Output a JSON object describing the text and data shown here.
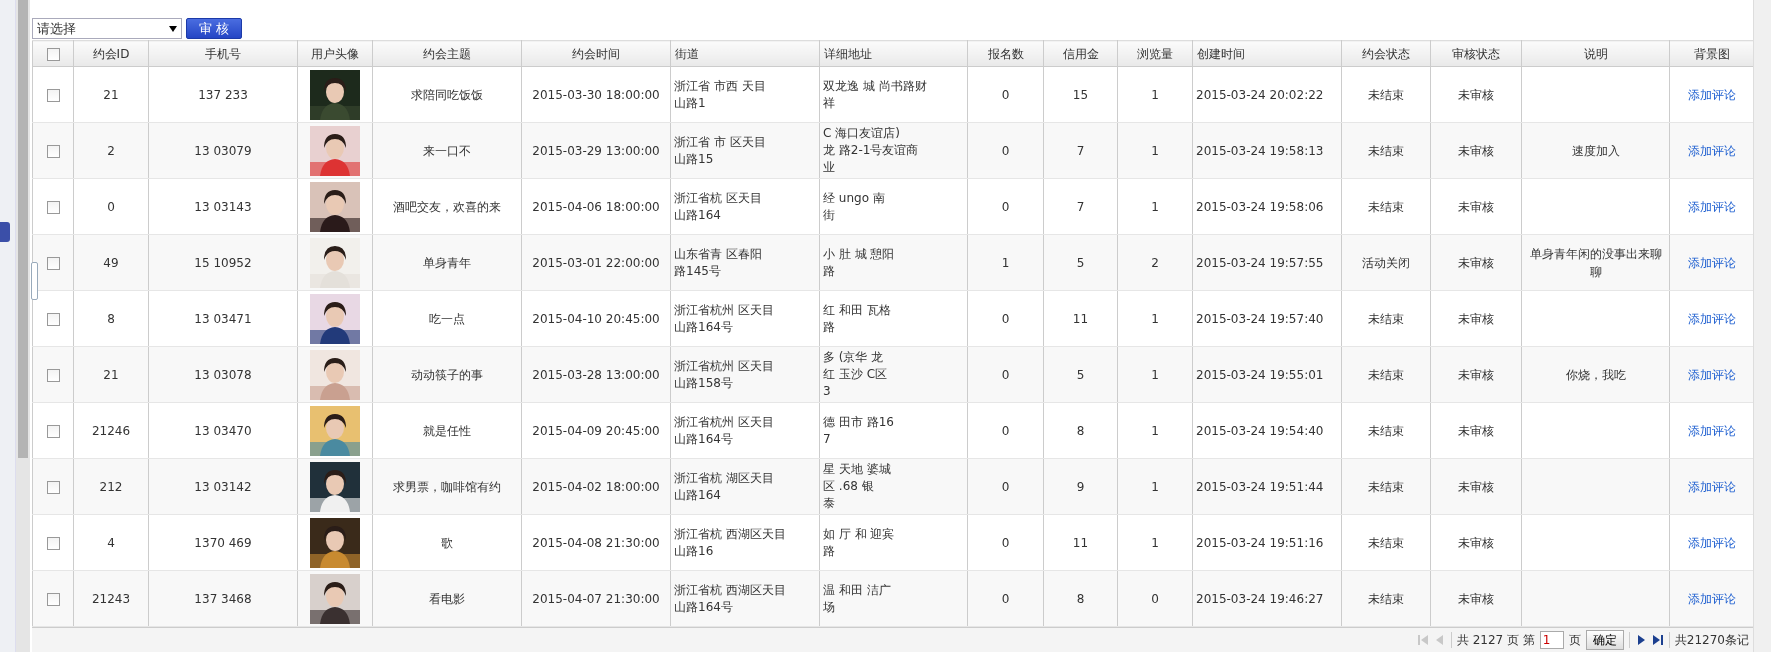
{
  "toolbar": {
    "select": {
      "value": "请选择"
    },
    "button": "审 核"
  },
  "table": {
    "header_checkbox": {
      "checked": false
    },
    "columns": [
      "约会ID",
      "手机号",
      "用户头像",
      "约会主题",
      "约会时间",
      "街道",
      "详细地址",
      "报名数",
      "信用金",
      "浏览量",
      "创建时间",
      "约会状态",
      "审核状态",
      "说明",
      "背景图"
    ],
    "rows": [
      {
        "checked": false,
        "id": "21",
        "phone": "137 233",
        "avatar": {
          "kind": "picture"
        },
        "subject": "求陪同吃饭饭",
        "time": "2015-03-30 18:00:00",
        "street": [
          "浙江省 市西 天目",
          "山路1"
        ],
        "address": [
          "双龙逸 城 尚书路财",
          "祥"
        ],
        "signups": "0",
        "credit": "15",
        "views": "1",
        "created": "2015-03-24 20:02:22",
        "status": "未结束",
        "review": "未审核",
        "action": "添加评论"
      },
      {
        "checked": false,
        "id": "2",
        "phone": "13 03079",
        "avatar": {
          "kind": "picture"
        },
        "subject": "来一口不",
        "time": "2015-03-29 13:00:00",
        "street": [
          "浙江省 市 区天目",
          "山路15"
        ],
        "address": [
          "C 海口友谊店)",
          "龙 路2-1号友谊商",
          "业"
        ],
        "signups": "0",
        "credit": "7",
        "views": "1",
        "created": "2015-03-24 19:58:13",
        "status": "未结束",
        "review": "未审核",
        "note": "速度加入",
        "action": "添加评论"
      },
      {
        "checked": false,
        "id": "0",
        "phone": "13 03143",
        "avatar": {
          "kind": "picture"
        },
        "subject": "酒吧交友，欢喜的来",
        "time": "2015-04-06 18:00:00",
        "street": [
          "浙江省杭 区天目",
          "山路164"
        ],
        "address": [
          "经 ungo 南",
          "街"
        ],
        "signups": "0",
        "credit": "7",
        "views": "1",
        "created": "2015-03-24 19:58:06",
        "status": "未结束",
        "review": "未审核",
        "action": "添加评论"
      },
      {
        "checked": false,
        "id": "49",
        "phone": "15 10952",
        "avatar": {
          "kind": "picture"
        },
        "subject": "单身青年",
        "time": "2015-03-01 22:00:00",
        "street": [
          "山东省青 区春阳",
          "路145号"
        ],
        "address": [
          "小 肚 城 憩阳",
          "路"
        ],
        "signups": "1",
        "credit": "5",
        "views": "2",
        "created": "2015-03-24 19:57:55",
        "status": "活动关闭",
        "review": "未审核",
        "note": "单身青年闲的没事出来聊聊",
        "action": "添加评论"
      },
      {
        "checked": false,
        "id": "8",
        "phone": "13 03471",
        "avatar": {
          "kind": "picture"
        },
        "subject": "吃一点",
        "time": "2015-04-10 20:45:00",
        "street": [
          "浙江省杭州 区天目",
          "山路164号"
        ],
        "address": [
          "红 和田 瓦格",
          "路"
        ],
        "signups": "0",
        "credit": "11",
        "views": "1",
        "created": "2015-03-24 19:57:40",
        "status": "未结束",
        "review": "未审核",
        "action": "添加评论"
      },
      {
        "checked": false,
        "id": "21",
        "phone": "13 03078",
        "avatar": {
          "kind": "picture"
        },
        "subject": "动动筷子的事",
        "time": "2015-03-28 13:00:00",
        "street": [
          "浙江省杭州 区天目",
          "山路158号"
        ],
        "address": [
          "多 (京华 龙",
          "红 玉沙 C区",
          "3"
        ],
        "signups": "0",
        "credit": "5",
        "views": "1",
        "created": "2015-03-24 19:55:01",
        "status": "未结束",
        "review": "未审核",
        "note": "你烧，我吃",
        "action": "添加评论"
      },
      {
        "checked": false,
        "id": "21246",
        "phone": "13 03470",
        "avatar": {
          "kind": "picture"
        },
        "subject": "就是任性",
        "time": "2015-04-09 20:45:00",
        "street": [
          "浙江省杭州 区天目",
          "山路164号"
        ],
        "address": [
          "德 田市 路16",
          "7"
        ],
        "signups": "0",
        "credit": "8",
        "views": "1",
        "created": "2015-03-24 19:54:40",
        "status": "未结束",
        "review": "未审核",
        "action": "添加评论"
      },
      {
        "checked": false,
        "id": "212",
        "phone": "13 03142",
        "avatar": {
          "kind": "picture"
        },
        "subject": "求男票，咖啡馆有约",
        "time": "2015-04-02 18:00:00",
        "street": [
          "浙江省杭 湖区天目",
          "山路164"
        ],
        "address": [
          "星 天地 婆城",
          "区 .68 银",
          "泰"
        ],
        "signups": "0",
        "credit": "9",
        "views": "1",
        "created": "2015-03-24 19:51:44",
        "status": "未结束",
        "review": "未审核",
        "action": "添加评论"
      },
      {
        "checked": false,
        "id": "4",
        "phone": "1370 469",
        "avatar": {
          "kind": "picture"
        },
        "subject": "歌",
        "time": "2015-04-08 21:30:00",
        "street": [
          "浙江省杭 西湖区天目",
          "山路16"
        ],
        "address": [
          "如 厅 和 迎宾",
          "路"
        ],
        "signups": "0",
        "credit": "11",
        "views": "1",
        "created": "2015-03-24 19:51:16",
        "status": "未结束",
        "review": "未审核",
        "action": "添加评论"
      },
      {
        "checked": false,
        "id": "21243",
        "phone": "137 3468",
        "avatar": {
          "kind": "picture"
        },
        "subject": "看电影",
        "time": "2015-04-07 21:30:00",
        "street": [
          "浙江省杭 西湖区天目",
          "山路164号"
        ],
        "address": [
          "温 和田 洁广",
          "场"
        ],
        "signups": "0",
        "credit": "8",
        "views": "0",
        "created": "2015-03-24 19:46:27",
        "status": "未结束",
        "review": "未审核",
        "action": "添加评论"
      }
    ]
  },
  "pager": {
    "first_disabled": true,
    "prev_disabled": true,
    "total_pages": "共 2127 页 第",
    "page_value": "1",
    "page_unit": "页",
    "go": "确定",
    "next_disabled": false,
    "last_disabled": false,
    "total_records": "共21270条记"
  }
}
